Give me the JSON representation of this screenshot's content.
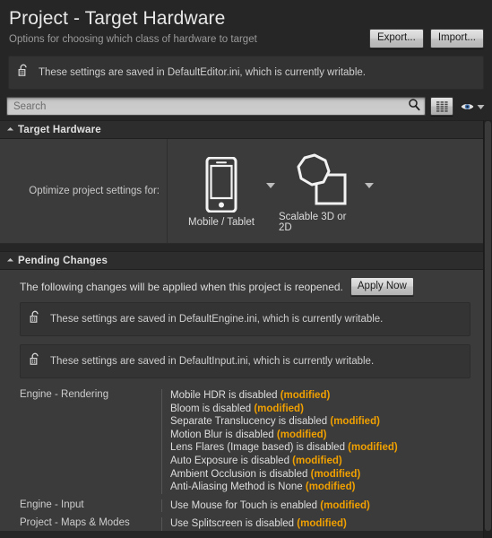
{
  "header": {
    "title": "Project - Target Hardware",
    "subtitle": "Options for choosing which class of hardware to target",
    "export_label": "Export...",
    "import_label": "Import..."
  },
  "top_info": {
    "text": "These settings are saved in DefaultEditor.ini, which is currently writable.",
    "icon": "unlock-icon"
  },
  "search": {
    "placeholder": "Search",
    "value": "",
    "magnifier_icon": "search-icon",
    "columns_icon": "column-view-icon",
    "visibility_icon": "eye-icon",
    "visibility_dropdown_icon": "chevron-down-icon"
  },
  "target_hardware": {
    "section_title": "Target Hardware",
    "collapse_icon": "expanded-triangle-icon",
    "row_label": "Optimize project settings for:",
    "options": [
      {
        "label": "Mobile / Tablet",
        "icon": "mobile-tablet-icon",
        "dropdown_icon": "combo-arrow-icon"
      },
      {
        "label": "Scalable 3D or 2D",
        "icon": "scalable-3d-2d-icon",
        "dropdown_icon": "combo-arrow-icon"
      }
    ]
  },
  "pending_changes": {
    "section_title": "Pending Changes",
    "collapse_icon": "expanded-triangle-icon",
    "notice": "The following changes will be applied when this project is reopened.",
    "apply_label": "Apply Now",
    "info_bars": [
      {
        "text": "These settings are saved in DefaultEngine.ini, which is currently writable.",
        "icon": "unlock-icon"
      },
      {
        "text": "These settings are saved in DefaultInput.ini, which is currently writable.",
        "icon": "unlock-icon"
      }
    ],
    "modified_tag": "(modified)",
    "modified_color": "#f0a000",
    "groups": [
      {
        "category": "Engine - Rendering",
        "items": [
          "Mobile HDR is disabled",
          "Bloom is disabled",
          "Separate Translucency is disabled",
          "Motion Blur is disabled",
          "Lens Flares (Image based) is disabled",
          "Auto Exposure is disabled",
          "Ambient Occlusion is disabled",
          "Anti-Aliasing Method is None"
        ]
      },
      {
        "category": "Engine - Input",
        "items": [
          "Use Mouse for Touch is enabled"
        ]
      },
      {
        "category": "Project - Maps & Modes",
        "items": [
          "Use Splitscreen is disabled"
        ]
      }
    ]
  }
}
